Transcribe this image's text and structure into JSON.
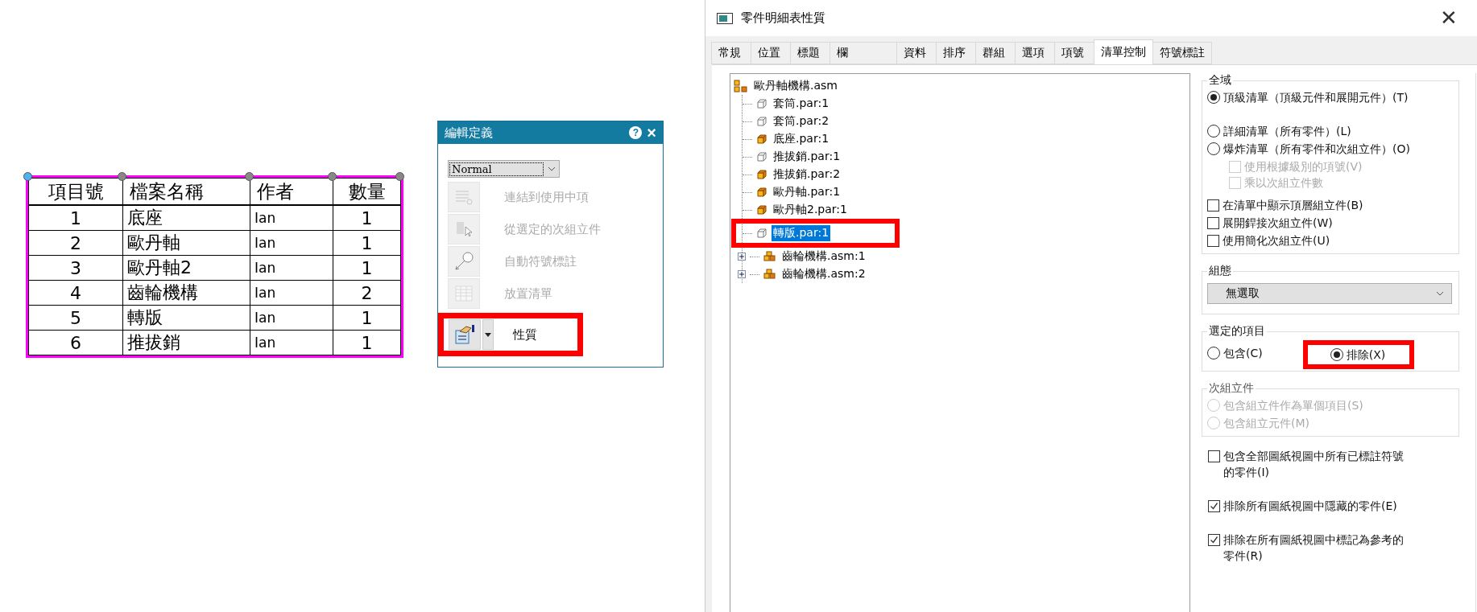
{
  "drawing_table": {
    "selected": true,
    "columns": [
      "項目號",
      "檔案名稱",
      "作者",
      "數量"
    ],
    "rows": [
      [
        "1",
        "底座",
        "Ian",
        "1"
      ],
      [
        "2",
        "歐丹軸",
        "Ian",
        "1"
      ],
      [
        "3",
        "歐丹軸2",
        "Ian",
        "1"
      ],
      [
        "4",
        "齒輪機構",
        "Ian",
        "2"
      ],
      [
        "5",
        "轉版",
        "Ian",
        "1"
      ],
      [
        "6",
        "推拔銷",
        "Ian",
        "1"
      ]
    ]
  },
  "edit_panel": {
    "title": "編輯定義",
    "help": "?",
    "close": "×",
    "style_select": "Normal",
    "actions": [
      {
        "kind": "link",
        "label": "連結到使用中項",
        "disabled": true,
        "highlighted": false
      },
      {
        "kind": "subassembly",
        "label": "從選定的次組立件",
        "disabled": true,
        "highlighted": false
      },
      {
        "kind": "balloon",
        "label": "自動符號標註",
        "disabled": true,
        "highlighted": false
      },
      {
        "kind": "grid",
        "label": "放置清單",
        "disabled": true,
        "highlighted": false
      },
      {
        "kind": "properties",
        "label": "性質",
        "disabled": false,
        "highlighted": true
      }
    ]
  },
  "dialog": {
    "title": "零件明細表性質",
    "close": "✕",
    "tabs": [
      {
        "label": "常規",
        "selected": false
      },
      {
        "label": "位置",
        "selected": false
      },
      {
        "label": "標題",
        "selected": false
      },
      {
        "label": "欄",
        "selected": false
      },
      {
        "label": "資料",
        "selected": false
      },
      {
        "label": "排序",
        "selected": false
      },
      {
        "label": "群組",
        "selected": false
      },
      {
        "label": "選項",
        "selected": false
      },
      {
        "label": "項號",
        "selected": false
      },
      {
        "label": "清單控制",
        "selected": true
      },
      {
        "label": "符號標註",
        "selected": false
      }
    ],
    "tree": {
      "kind": "assembly",
      "label": "歐丹軸機構.asm",
      "selected": false,
      "highlighted": false,
      "children": [
        {
          "kind": "ghost",
          "label": "套筒.par:1",
          "selected": false,
          "highlighted": false
        },
        {
          "kind": "ghost",
          "label": "套筒.par:2",
          "selected": false,
          "highlighted": false
        },
        {
          "kind": "part",
          "label": "底座.par:1",
          "selected": false,
          "highlighted": false
        },
        {
          "kind": "ghost",
          "label": "推拔銷.par:1",
          "selected": false,
          "highlighted": false
        },
        {
          "kind": "part",
          "label": "推拔銷.par:2",
          "selected": false,
          "highlighted": false
        },
        {
          "kind": "part",
          "label": "歐丹軸.par:1",
          "selected": false,
          "highlighted": false
        },
        {
          "kind": "part",
          "label": "歐丹軸2.par:1",
          "selected": false,
          "highlighted": false
        },
        {
          "kind": "ghost",
          "label": "轉版.par:1",
          "selected": true,
          "highlighted": true
        },
        {
          "kind": "subassembly",
          "label": "齒輪機構.asm:1",
          "selected": false,
          "highlighted": false,
          "expanded": false
        },
        {
          "kind": "subassembly",
          "label": "齒輪機構.asm:2",
          "selected": false,
          "highlighted": false,
          "expanded": false
        }
      ]
    },
    "scope": {
      "title": "全域",
      "options": [
        {
          "kind": "radio",
          "label": "頂級清單（頂級元件和展開元件）(T)",
          "selected": true,
          "disabled": false
        },
        {
          "kind": "radio",
          "label": "詳細清單（所有零件）(L)",
          "selected": false,
          "disabled": false
        },
        {
          "kind": "radio",
          "label": "爆炸清單（所有零件和次組立件）(O)",
          "selected": false,
          "disabled": false,
          "children": [
            {
              "kind": "checkbox",
              "label": "使用根據級別的項號(V)",
              "checked": false,
              "disabled": true
            },
            {
              "kind": "checkbox",
              "label": "乘以次組立件數",
              "checked": false,
              "disabled": true
            }
          ]
        },
        {
          "kind": "checkbox",
          "label": "在清單中顯示頂層組立件(B)",
          "checked": false,
          "disabled": false
        },
        {
          "kind": "checkbox",
          "label": "展開銲接次組立件(W)",
          "checked": false,
          "disabled": false
        },
        {
          "kind": "checkbox",
          "label": "使用簡化次組立件(U)",
          "checked": false,
          "disabled": false
        }
      ]
    },
    "configuration": {
      "title": "組態",
      "value": "無選取"
    },
    "selected_items": {
      "title": "選定的項目",
      "options": [
        {
          "label": "包含(C)",
          "selected": false,
          "highlighted": false
        },
        {
          "label": "排除(X)",
          "selected": true,
          "highlighted": true
        }
      ]
    },
    "subassembly": {
      "title": "次組立件",
      "options": [
        {
          "label": "包含組立件作為單個項目(S)",
          "selected": false,
          "disabled": true
        },
        {
          "label": "包含組立元件(M)",
          "selected": false,
          "disabled": true
        }
      ]
    },
    "extra_options": [
      {
        "label": "包含全部圖紙視圖中所有已標註符號的零件(I)",
        "checked": false
      },
      {
        "label": "排除所有圖紙視圖中隱藏的零件(E)",
        "checked": true
      },
      {
        "label": "排除在所有圖紙視圖中標記為參考的零件(R)",
        "checked": true
      }
    ]
  }
}
